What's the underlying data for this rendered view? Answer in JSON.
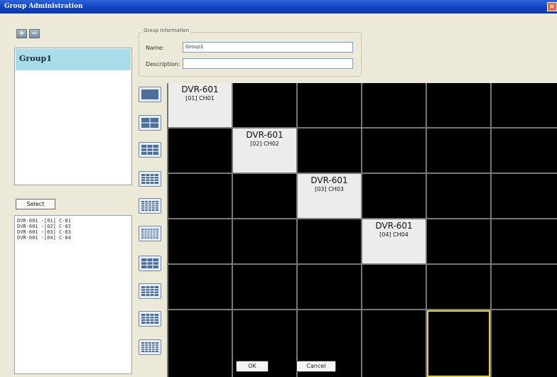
{
  "window": {
    "title": "Group Administration",
    "close_symbol": "×"
  },
  "toolbar": {
    "add_symbol": "+",
    "remove_symbol": "−"
  },
  "groups": [
    {
      "label": "Group1"
    }
  ],
  "select_button": "Select",
  "channel_list": [
    "DVR-601 -[01] C-01",
    "DVR-601 -[02] C-02",
    "DVR-601 -[03] C-03",
    "DVR-601 -[04] C-04"
  ],
  "group_info": {
    "legend": "Group Information",
    "name_label": "Name:",
    "name_value": "Group1",
    "description_label": "Description:",
    "description_value": ""
  },
  "layout_icons": [
    "layout-1x1-icon",
    "layout-2x2-icon",
    "layout-3x3-icon",
    "layout-4x4-icon",
    "layout-5x5-icon",
    "layout-6x6-icon",
    "layout-1plus5-icon",
    "layout-1plus7-icon",
    "layout-1plus9-icon",
    "layout-1plus12-icon"
  ],
  "grid": {
    "rows": 6,
    "cols": 6,
    "assigned": [
      {
        "row": 0,
        "col": 0,
        "device": "DVR-601",
        "channel": "[01] CH01"
      },
      {
        "row": 1,
        "col": 1,
        "device": "DVR-601",
        "channel": "[02] CH02"
      },
      {
        "row": 2,
        "col": 2,
        "device": "DVR-601",
        "channel": "[03] CH03"
      },
      {
        "row": 3,
        "col": 3,
        "device": "DVR-601",
        "channel": "[04] CH04"
      }
    ],
    "selected": {
      "row": 5,
      "col": 4
    }
  },
  "buttons": {
    "ok": "OK",
    "cancel": "Cancel"
  },
  "colors": {
    "title_bar": "#1144c3",
    "group_highlight": "#a8dce8",
    "selected_cell": "#e1cf3b"
  }
}
